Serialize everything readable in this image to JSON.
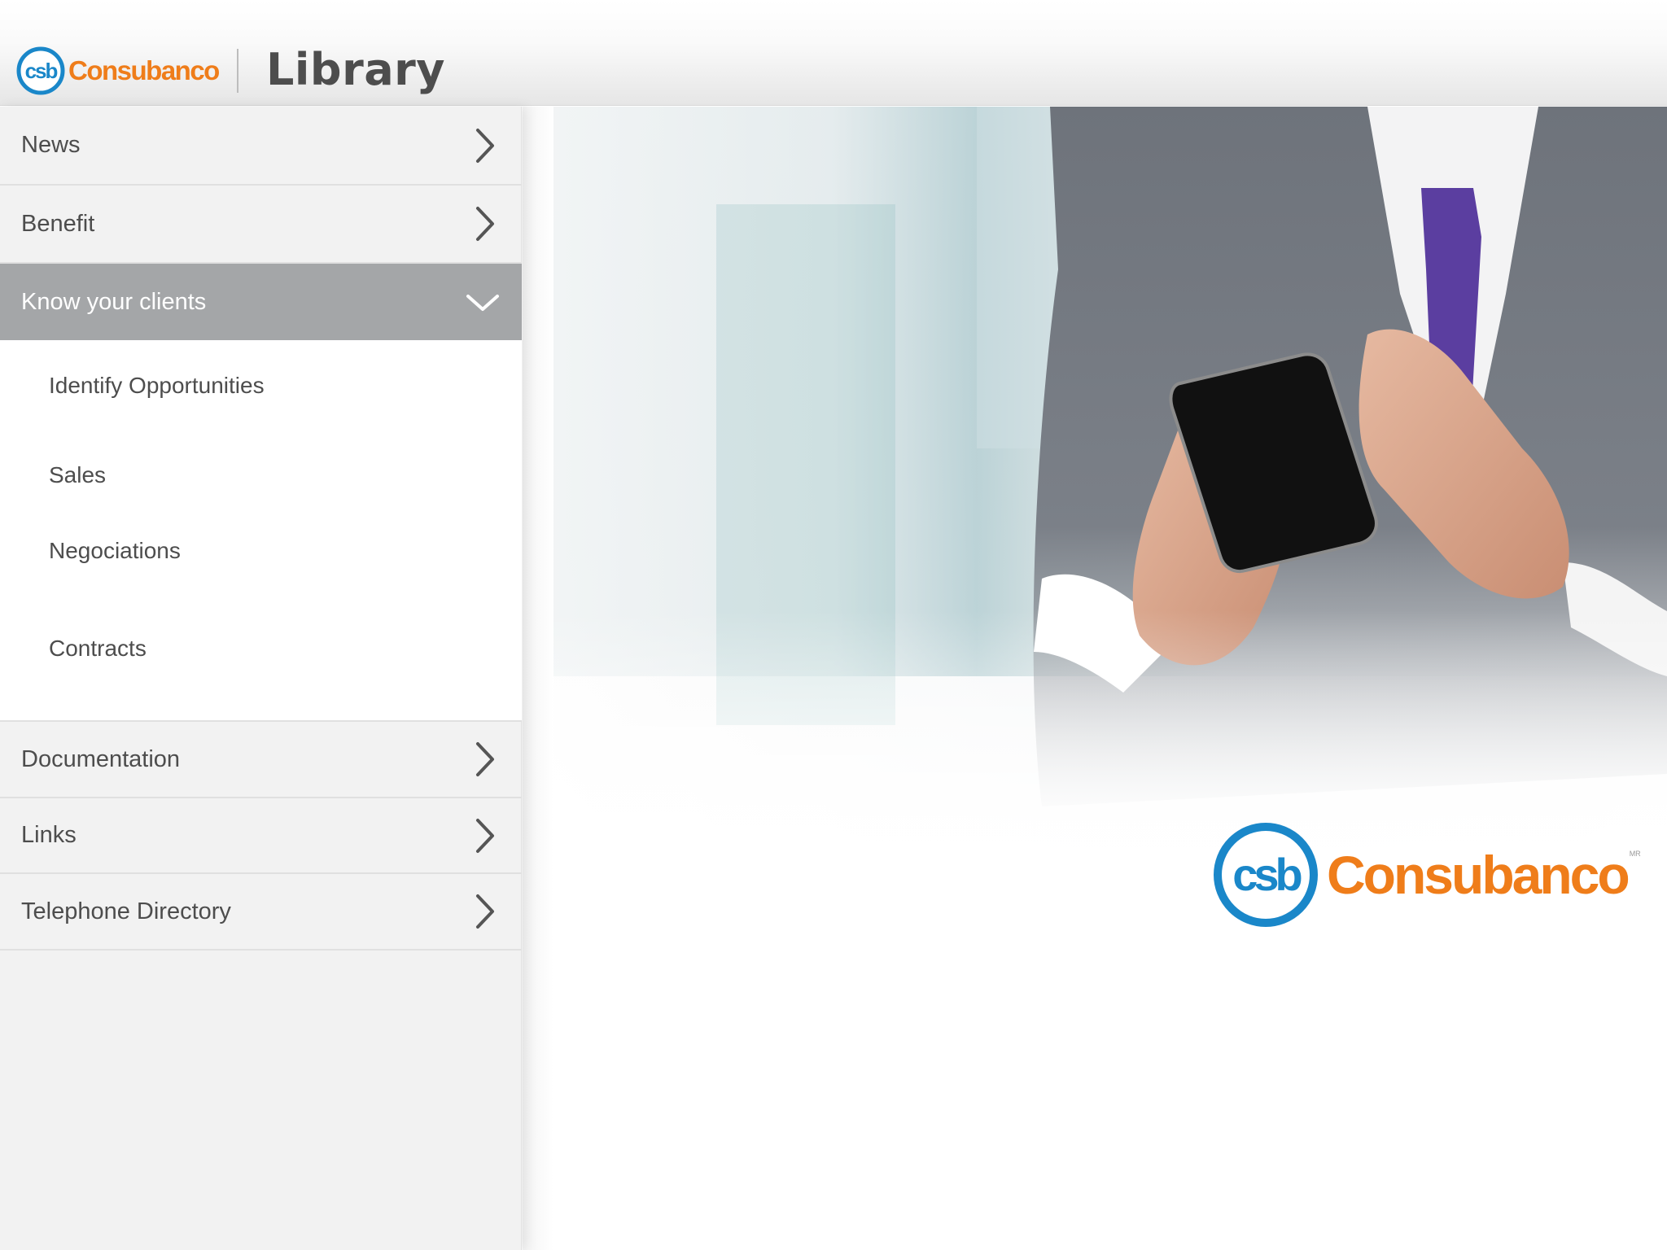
{
  "header": {
    "brand_name": "Consubanco",
    "brand_badge": "csb",
    "title": "Library"
  },
  "sidebar": {
    "items": [
      {
        "label": "News",
        "icon": "chevron-right-icon"
      },
      {
        "label": "Benefit",
        "icon": "chevron-right-icon"
      },
      {
        "label": "Know your clients",
        "icon": "chevron-down-icon",
        "expanded": true
      },
      {
        "label": "Documentation",
        "icon": "chevron-right-icon"
      },
      {
        "label": "Links",
        "icon": "chevron-right-icon"
      },
      {
        "label": "Telephone Directory",
        "icon": "chevron-right-icon"
      }
    ],
    "subitems": [
      {
        "label": "Identify Opportunities"
      },
      {
        "label": "Sales"
      },
      {
        "label": "Negociations"
      },
      {
        "label": "Contracts"
      }
    ]
  },
  "hero": {
    "brand_name": "Consubanco",
    "brand_badge": "csb",
    "brand_mark": "MR"
  },
  "colors": {
    "brand_orange": "#ef7d1a",
    "brand_blue": "#1a87c9",
    "active_menu": "#a4a6a8",
    "sidebar_bg": "#f2f2f2"
  }
}
